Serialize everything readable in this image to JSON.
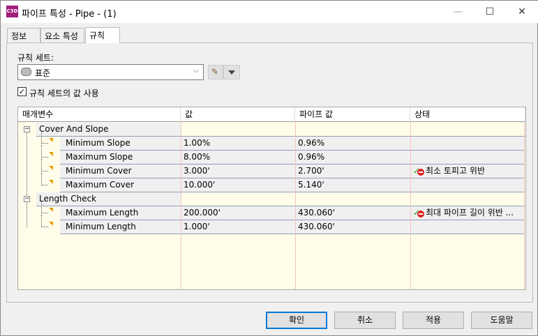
{
  "window": {
    "title": "파이프 특성 - Pipe - (1)",
    "app_icon": "C3D",
    "minimize": "—",
    "maximize": "☐",
    "close": "✕"
  },
  "tabs": [
    {
      "label": "정보"
    },
    {
      "label": "요소 특성"
    },
    {
      "label": "규칙",
      "active": true
    }
  ],
  "rules": {
    "ruleset_label": "규칙 세트:",
    "ruleset_value": "표준",
    "use_values_label": "규칙 세트의 값 사용",
    "use_values_checked": true
  },
  "grid": {
    "columns": [
      "매개변수",
      "값",
      "파이프 값",
      "상태"
    ],
    "groups": [
      {
        "name": "Cover And Slope",
        "rows": [
          {
            "param": "Minimum Slope",
            "value": "1.00%",
            "pipe": "0.96%",
            "status": ""
          },
          {
            "param": "Maximum Slope",
            "value": "8.00%",
            "pipe": "0.96%",
            "status": ""
          },
          {
            "param": "Minimum Cover",
            "value": "3.000'",
            "pipe": "2.700'",
            "status": "최소 토피고 위반"
          },
          {
            "param": "Maximum Cover",
            "value": "10.000'",
            "pipe": "5.140'",
            "status": ""
          }
        ]
      },
      {
        "name": "Length Check",
        "rows": [
          {
            "param": "Maximum Length",
            "value": "200.000'",
            "pipe": "430.060'",
            "status": "최대 파이프 길이 위반 ..."
          },
          {
            "param": "Minimum Length",
            "value": "1.000'",
            "pipe": "430.060'",
            "status": ""
          }
        ]
      }
    ]
  },
  "buttons": {
    "ok": "확인",
    "cancel": "취소",
    "apply": "적용",
    "help": "도움말"
  },
  "colors": {
    "accent": "#0078d7",
    "grid_bg": "#fffde9",
    "violation": "#e02020"
  }
}
